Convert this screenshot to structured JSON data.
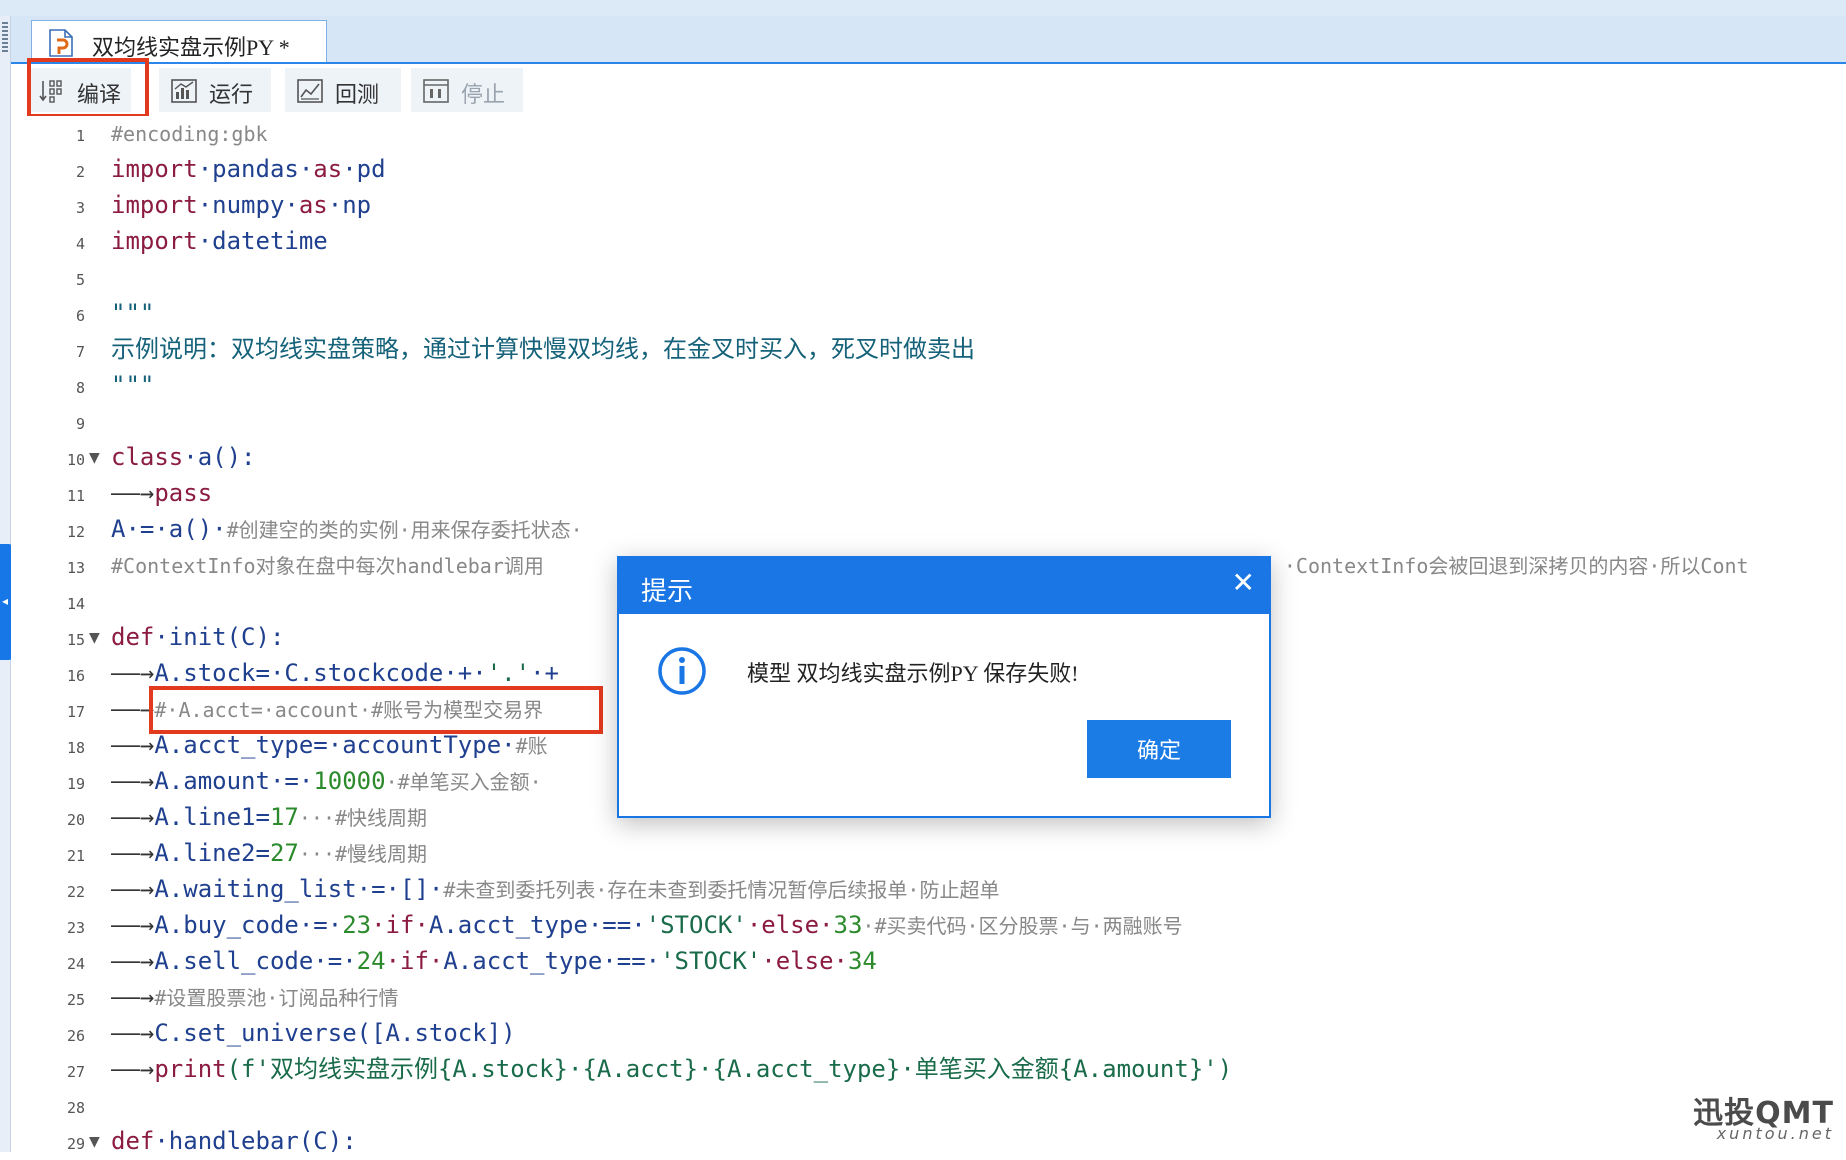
{
  "tab": {
    "title": "双均线实盘示例PY *",
    "icon": "python-file-icon"
  },
  "toolbar": {
    "compile_label": "编译",
    "run_label": "运行",
    "backtest_label": "回测",
    "stop_label": "停止"
  },
  "editor": {
    "lines": [
      {
        "n": "1"
      },
      {
        "n": "2"
      },
      {
        "n": "3"
      },
      {
        "n": "4"
      },
      {
        "n": "5"
      },
      {
        "n": "6"
      },
      {
        "n": "7"
      },
      {
        "n": "8"
      },
      {
        "n": "9"
      },
      {
        "n": "10"
      },
      {
        "n": "11"
      },
      {
        "n": "12"
      },
      {
        "n": "13"
      },
      {
        "n": "14"
      },
      {
        "n": "15"
      },
      {
        "n": "16"
      },
      {
        "n": "17"
      },
      {
        "n": "18"
      },
      {
        "n": "19"
      },
      {
        "n": "20"
      },
      {
        "n": "21"
      },
      {
        "n": "22"
      },
      {
        "n": "23"
      },
      {
        "n": "24"
      },
      {
        "n": "25"
      },
      {
        "n": "26"
      },
      {
        "n": "27"
      },
      {
        "n": "28"
      },
      {
        "n": "29"
      }
    ],
    "code": {
      "l1": "#encoding:gbk",
      "l2_kw": "import",
      "l2_mod": "·pandas·",
      "l2_as": "as",
      "l2_alias": "·pd",
      "l3_kw": "import",
      "l3_mod": "·numpy·",
      "l3_as": "as",
      "l3_alias": "·np",
      "l4_kw": "import",
      "l4_mod": "·datetime",
      "l6": "\"\"\"",
      "l7": "示例说明：双均线实盘策略，通过计算快慢双均线，在金叉时买入，死叉时做卖出",
      "l8": "\"\"\"",
      "l10_kw": "class",
      "l10_rest": "·a():",
      "l11_arrow": "——→",
      "l11_kw": "pass",
      "l12_code": "A·=·a()·",
      "l12_com": "#创建空的类的实例·用来保存委托状态·",
      "l13_com_a": "#ContextInfo对象在盘中每次handlebar调用",
      "l13_com_b": "·ContextInfo会被回退到深拷贝的内容·所以Cont",
      "l15_kw": "def",
      "l15_rest": "·init(C):",
      "l16_arrow": "——→",
      "l16_code": "A.stock=·C.stockcode·+·",
      "l16_str": "'.'",
      "l16_tail": "·+",
      "l17_arrow": "——→",
      "l17_com": "#·A.acct=·account·#账号为模型交易界",
      "l18_arrow": "——→",
      "l18_code": "A.acct_type=·accountType·",
      "l18_com": "#账",
      "l19_arrow": "——→",
      "l19_code": "A.amount·=·",
      "l19_num": "10000",
      "l19_com": "·#单笔买入金额·",
      "l20_arrow": "——→",
      "l20_code": "A.line1=",
      "l20_num": "17",
      "l20_com": "···#快线周期",
      "l21_arrow": "——→",
      "l21_code": "A.line2=",
      "l21_num": "27",
      "l21_com": "···#慢线周期",
      "l22_arrow": "——→",
      "l22_code": "A.waiting_list·=·[]·",
      "l22_com": "#未查到委托列表·存在未查到委托情况暂停后续报单·防止超单",
      "l23_arrow": "——→",
      "l23_code1": "A.buy_code·=·",
      "l23_num1": "23",
      "l23_if": "·if·",
      "l23_code2": "A.acct_type·==·",
      "l23_str": "'STOCK'",
      "l23_else": "·else·",
      "l23_num2": "33",
      "l23_com": "·#买卖代码·区分股票·与·两融账号",
      "l24_arrow": "——→",
      "l24_code1": "A.sell_code·=·",
      "l24_num1": "24",
      "l24_if": "·if·",
      "l24_code2": "A.acct_type·==·",
      "l24_str": "'STOCK'",
      "l24_else": "·else·",
      "l24_num2": "34",
      "l25_arrow": "——→",
      "l25_com": "#设置股票池·订阅品种行情",
      "l26_arrow": "——→",
      "l26_code": "C.set_universe([A.stock])",
      "l27_arrow": "——→",
      "l27_kw": "print",
      "l27_str": "(f'双均线实盘示例{A.stock}·{A.acct}·{A.acct_type}·单笔买入金额{A.amount}')",
      "l29_kw": "def",
      "l29_rest": "·handlebar(C):"
    }
  },
  "dialog": {
    "title": "提示",
    "message": "模型  双均线实盘示例PY  保存失败!",
    "ok_label": "确定",
    "close_glyph": "✕",
    "icon": "info-icon"
  },
  "watermark": {
    "main": "迅投QMT",
    "sub": "xuntou.net"
  },
  "colors": {
    "accent": "#1976e4",
    "highlight_box": "#e23a1f"
  }
}
